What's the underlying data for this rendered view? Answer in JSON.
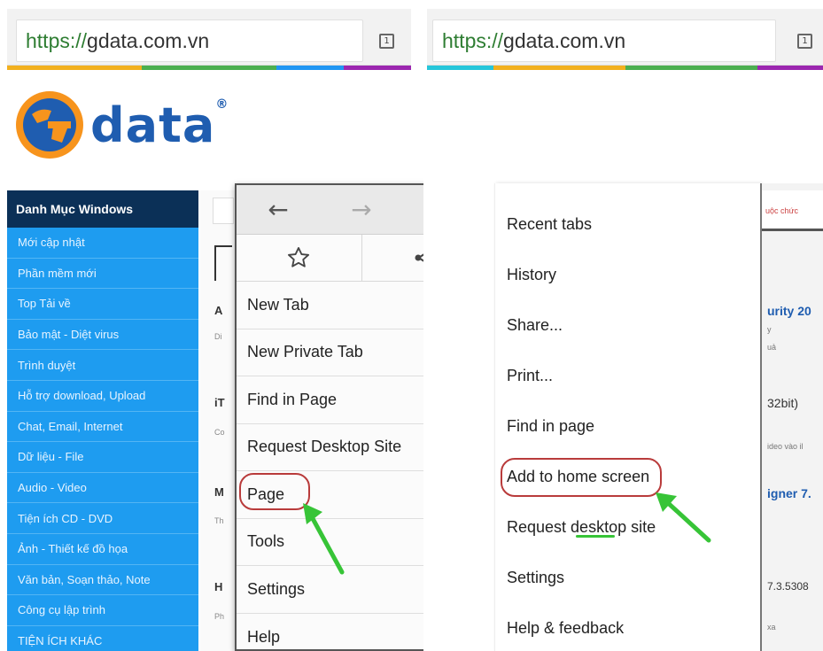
{
  "left_browser": {
    "url_scheme": "https://",
    "url_host": "gdata.com.vn",
    "tab_count": "1",
    "logo_text": "data",
    "logo_mark": "®"
  },
  "right_browser": {
    "url_scheme": "https://",
    "url_host": "gdata.com.vn",
    "tab_count": "1"
  },
  "sidebar": {
    "title": "Danh Mục Windows",
    "items": [
      "Mới cập nhật",
      "Phần mềm mới",
      "Top Tải về",
      "Bảo mật - Diệt virus",
      "Trình duyệt",
      "Hỗ trợ download, Upload",
      "Chat, Email, Internet",
      "Dữ liệu - File",
      "Audio - Video",
      "Tiện ích CD - DVD",
      "Ảnh - Thiết kế đồ họa",
      "Văn bản, Soạn thảo, Note",
      "Công cụ lập trình",
      "TIỆN ÍCH KHÁC"
    ]
  },
  "page_fragments": {
    "items": [
      "A",
      "iT",
      "M",
      "H"
    ],
    "smalls": [
      "Di",
      "Co",
      "Th",
      "Ph"
    ]
  },
  "firefox_menu": {
    "nav_icons": [
      "back-arrow-icon",
      "forward-arrow-icon",
      "reload-icon"
    ],
    "action_icons": [
      "star-icon",
      "share-icon"
    ],
    "items": [
      {
        "label": "New Tab"
      },
      {
        "label": "New Private Tab"
      },
      {
        "label": "Find in Page"
      },
      {
        "label": "Request Desktop Site"
      },
      {
        "label": "Page"
      },
      {
        "label": "Tools"
      },
      {
        "label": "Settings"
      },
      {
        "label": "Help"
      }
    ]
  },
  "chrome_menu": {
    "items": [
      "Recent tabs",
      "History",
      "Share...",
      "Print...",
      "Find in page",
      "Add to home screen",
      "Request desktop site",
      "Settings",
      "Help & feedback"
    ]
  },
  "right_background": {
    "topbar_text": "uộc chức",
    "texts": [
      "urity 20",
      "32bit)",
      "igner 7.",
      "7.3.5308"
    ],
    "smalls": [
      "y",
      "uả",
      "ideo vào il",
      "xa"
    ]
  },
  "colors": {
    "annotation_oval": "#b93b3b",
    "annotation_arrow": "#37c437",
    "sidebar_bg": "#1e9cf0",
    "sidebar_head": "#0b3057",
    "url_green": "#2e7d32",
    "logo_blue": "#1f5db0"
  }
}
